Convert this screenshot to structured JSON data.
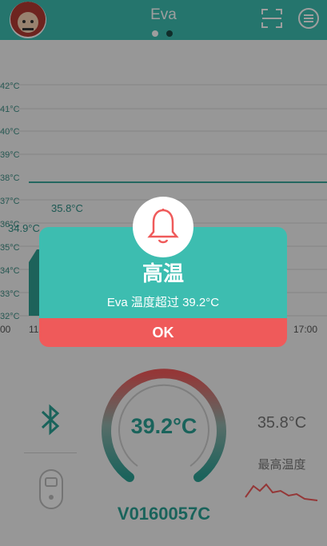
{
  "header": {
    "title": "Eva"
  },
  "chart": {
    "y_ticks": [
      "42°C",
      "41°C",
      "40°C",
      "39°C",
      "38°C",
      "37°C",
      "36°C",
      "35°C",
      "34°C",
      "33°C",
      "32°C"
    ],
    "x_ticks": [
      "00",
      "11",
      "17:00"
    ],
    "notes": [
      "35.8°C",
      "34.9°C"
    ]
  },
  "gauge": {
    "value": "39.2°C"
  },
  "device": {
    "id": "V0160057C"
  },
  "max": {
    "value": "35.8°C",
    "label": "最高温度"
  },
  "dialog": {
    "title": "高温",
    "message": "Eva 温度超过 39.2°C",
    "ok_label": "OK"
  },
  "colors": {
    "accent": "#3dbdb0",
    "alert": "#ef5a5a"
  },
  "icons": {
    "scan": "scan-icon",
    "menu": "menu-icon",
    "bell": "bell-icon",
    "bluetooth": "bluetooth-icon",
    "device": "thermometer-device-icon"
  }
}
